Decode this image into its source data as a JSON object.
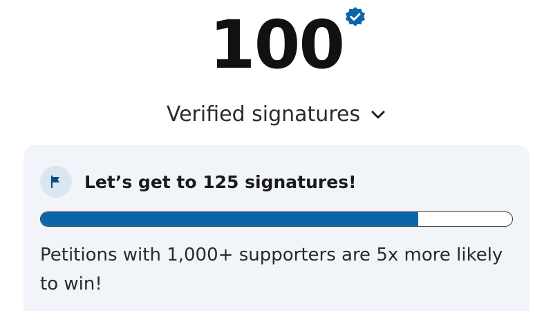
{
  "count": "100",
  "verified_label": "Verified signatures",
  "goal": {
    "text": "Let’s get to 125 signatures!",
    "progress_fraction": 0.8
  },
  "note": "Petitions with 1,000+ supporters are 5x more likely to win!",
  "icons": {
    "badge": "verified-badge-icon",
    "chevron": "chevron-down-icon",
    "flag": "flag-icon"
  },
  "colors": {
    "accent": "#0a66a8",
    "card_bg": "#f1f5f9",
    "flag_circle_bg": "#dbe6f1"
  }
}
